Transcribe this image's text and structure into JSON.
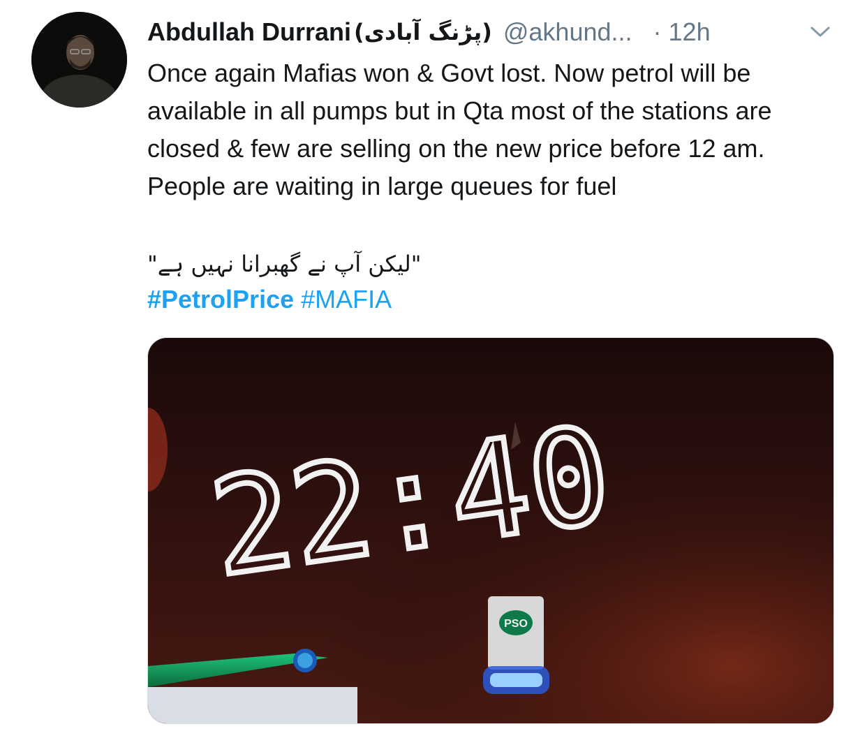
{
  "tweet": {
    "display_name": "Abdullah Durrani",
    "display_name_urdu": "(پڑنگ آبادی)",
    "handle": "@akhund...",
    "separator": "·",
    "time": "12h",
    "text": "Once again Mafias won & Govt lost. Now petrol will be available in all pumps but in Qta most of the stations are closed & few are selling on the new price before 12 am. People are waiting in large queues for fuel",
    "urdu_quote": "\"لیکن آپ نے گھبرانا نہیں ہے\"",
    "hashtags": [
      {
        "text": "#PetrolPrice"
      },
      {
        "text": "#MAFIA"
      }
    ],
    "colors": {
      "text": "#14171a",
      "secondary": "#657786",
      "link": "#1da1f2"
    },
    "media": {
      "clock_text": "22:40",
      "sign_text": "PSO"
    }
  }
}
